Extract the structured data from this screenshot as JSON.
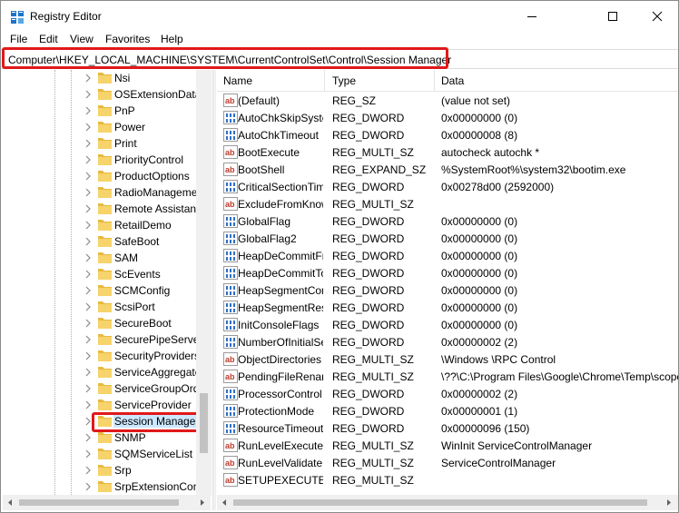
{
  "window": {
    "title": "Registry Editor",
    "app_icon": "registry-editor-icon",
    "controls": [
      "minimize-icon",
      "maximize-icon",
      "close-icon"
    ]
  },
  "menu": {
    "file": "File",
    "edit": "Edit",
    "view": "View",
    "favorites": "Favorites",
    "help": "Help"
  },
  "address": {
    "path": "Computer\\HKEY_LOCAL_MACHINE\\SYSTEM\\CurrentControlSet\\Control\\Session Manager",
    "highlight_color": "#e0191a"
  },
  "tree": {
    "items": [
      {
        "label": "Nsi"
      },
      {
        "label": "OSExtensionData"
      },
      {
        "label": "PnP"
      },
      {
        "label": "Power"
      },
      {
        "label": "Print"
      },
      {
        "label": "PriorityControl"
      },
      {
        "label": "ProductOptions"
      },
      {
        "label": "RadioManagement"
      },
      {
        "label": "Remote Assistance"
      },
      {
        "label": "RetailDemo"
      },
      {
        "label": "SafeBoot"
      },
      {
        "label": "SAM"
      },
      {
        "label": "ScEvents"
      },
      {
        "label": "SCMConfig"
      },
      {
        "label": "ScsiPort"
      },
      {
        "label": "SecureBoot"
      },
      {
        "label": "SecurePipeServers"
      },
      {
        "label": "SecurityProviders"
      },
      {
        "label": "ServiceAggregatedEvents"
      },
      {
        "label": "ServiceGroupOrder"
      },
      {
        "label": "ServiceProvider"
      },
      {
        "label": "Session Manager"
      },
      {
        "label": "SNMP"
      },
      {
        "label": "SQMServiceList"
      },
      {
        "label": "Srp"
      },
      {
        "label": "SrpExtensionConfig"
      }
    ],
    "selected_index": 21
  },
  "list": {
    "columns": {
      "name": "Name",
      "type": "Type",
      "data": "Data"
    },
    "rows": [
      {
        "icon": "string-value-icon",
        "name": "(Default)",
        "type": "REG_SZ",
        "data": "(value not set)"
      },
      {
        "icon": "binary-value-icon",
        "name": "AutoChkSkipSystemPartition",
        "type": "REG_DWORD",
        "data": "0x00000000 (0)"
      },
      {
        "icon": "binary-value-icon",
        "name": "AutoChkTimeout",
        "type": "REG_DWORD",
        "data": "0x00000008 (8)"
      },
      {
        "icon": "string-value-icon",
        "name": "BootExecute",
        "type": "REG_MULTI_SZ",
        "data": "autocheck autochk *"
      },
      {
        "icon": "string-value-icon",
        "name": "BootShell",
        "type": "REG_EXPAND_SZ",
        "data": "%SystemRoot%\\system32\\bootim.exe"
      },
      {
        "icon": "binary-value-icon",
        "name": "CriticalSectionTimeout",
        "type": "REG_DWORD",
        "data": "0x00278d00 (2592000)"
      },
      {
        "icon": "string-value-icon",
        "name": "ExcludeFromKnownDlls",
        "type": "REG_MULTI_SZ",
        "data": ""
      },
      {
        "icon": "binary-value-icon",
        "name": "GlobalFlag",
        "type": "REG_DWORD",
        "data": "0x00000000 (0)"
      },
      {
        "icon": "binary-value-icon",
        "name": "GlobalFlag2",
        "type": "REG_DWORD",
        "data": "0x00000000 (0)"
      },
      {
        "icon": "binary-value-icon",
        "name": "HeapDeCommitFreeBlockThreshold",
        "type": "REG_DWORD",
        "data": "0x00000000 (0)"
      },
      {
        "icon": "binary-value-icon",
        "name": "HeapDeCommitTotalFreeThreshold",
        "type": "REG_DWORD",
        "data": "0x00000000 (0)"
      },
      {
        "icon": "binary-value-icon",
        "name": "HeapSegmentCommit",
        "type": "REG_DWORD",
        "data": "0x00000000 (0)"
      },
      {
        "icon": "binary-value-icon",
        "name": "HeapSegmentReserve",
        "type": "REG_DWORD",
        "data": "0x00000000 (0)"
      },
      {
        "icon": "binary-value-icon",
        "name": "InitConsoleFlags",
        "type": "REG_DWORD",
        "data": "0x00000000 (0)"
      },
      {
        "icon": "binary-value-icon",
        "name": "NumberOfInitialSessions",
        "type": "REG_DWORD",
        "data": "0x00000002 (2)"
      },
      {
        "icon": "string-value-icon",
        "name": "ObjectDirectories",
        "type": "REG_MULTI_SZ",
        "data": "\\Windows \\RPC Control"
      },
      {
        "icon": "string-value-icon",
        "name": "PendingFileRenameOperations",
        "type": "REG_MULTI_SZ",
        "data": "\\??\\C:\\Program Files\\Google\\Chrome\\Temp\\scoped_dir"
      },
      {
        "icon": "binary-value-icon",
        "name": "ProcessorControl",
        "type": "REG_DWORD",
        "data": "0x00000002 (2)"
      },
      {
        "icon": "binary-value-icon",
        "name": "ProtectionMode",
        "type": "REG_DWORD",
        "data": "0x00000001 (1)"
      },
      {
        "icon": "binary-value-icon",
        "name": "ResourceTimeoutCount",
        "type": "REG_DWORD",
        "data": "0x00000096 (150)"
      },
      {
        "icon": "string-value-icon",
        "name": "RunLevelExecute",
        "type": "REG_MULTI_SZ",
        "data": "WinInit ServiceControlManager"
      },
      {
        "icon": "string-value-icon",
        "name": "RunLevelValidate",
        "type": "REG_MULTI_SZ",
        "data": "ServiceControlManager"
      },
      {
        "icon": "string-value-icon",
        "name": "SETUPEXECUTE",
        "type": "REG_MULTI_SZ",
        "data": ""
      }
    ]
  },
  "colors": {
    "highlight": "#e0191a",
    "selection": "#cce8ff",
    "folder": "#f6d36b",
    "string_icon": "#c0392b",
    "binary_icon": "#2e6fc6"
  }
}
